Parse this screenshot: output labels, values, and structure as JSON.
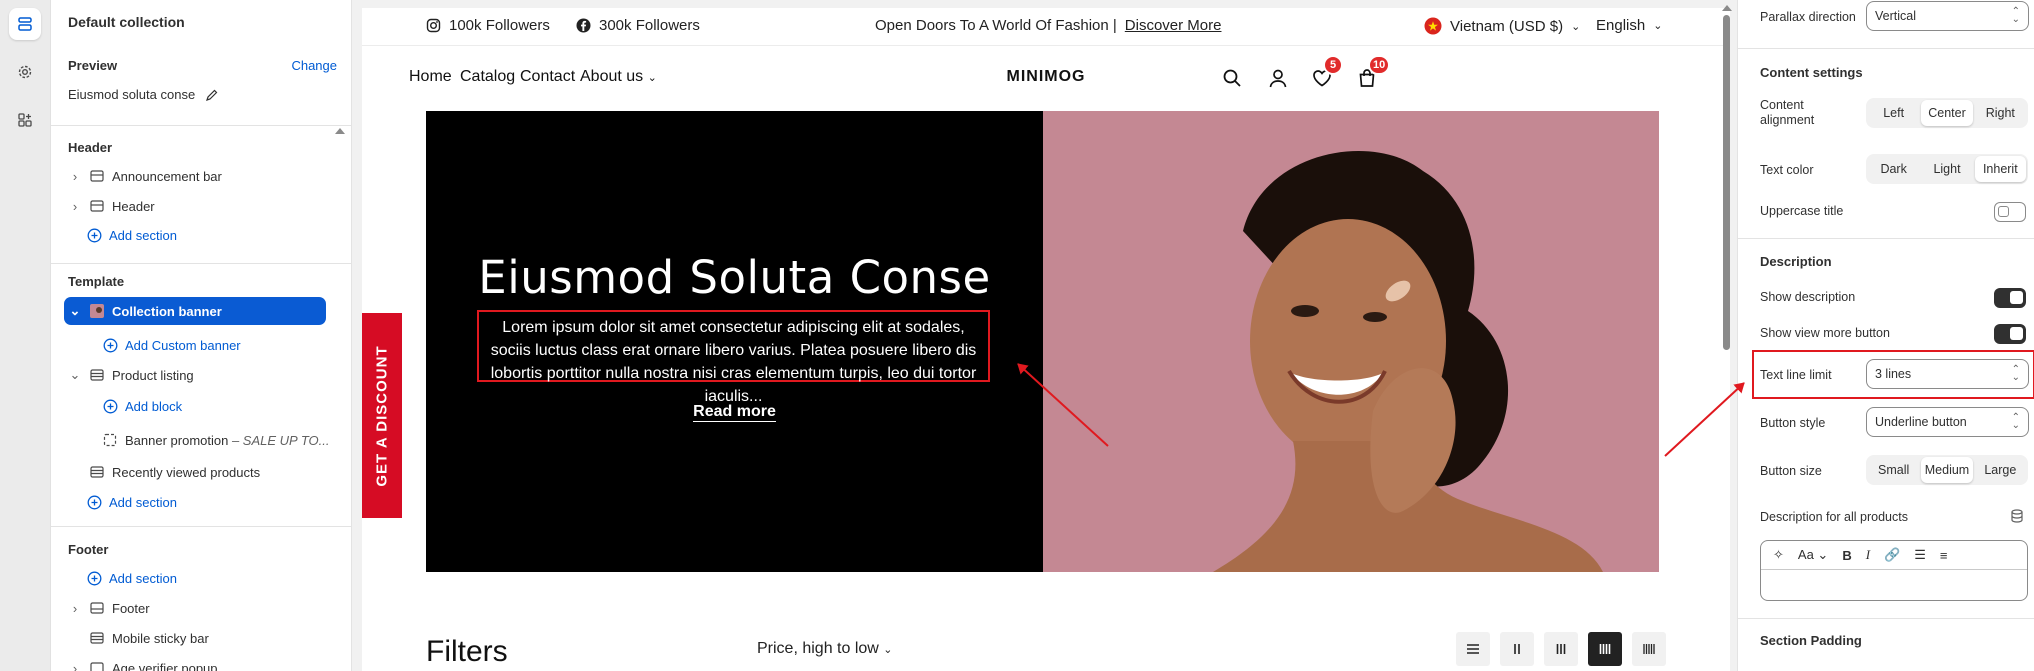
{
  "sidebar": {
    "title": "Default collection",
    "preview_label": "Preview",
    "change_label": "Change",
    "preview_value": "Eiusmod soluta conse",
    "header_group": "Header",
    "header_items": [
      "Announcement bar",
      "Header"
    ],
    "add_section": "Add section",
    "template_group": "Template",
    "selected_item": "Collection banner",
    "add_custom_banner": "Add Custom banner",
    "product_listing": "Product listing",
    "add_block": "Add block",
    "banner_promotion": "Banner promotion",
    "banner_promotion_suffix": "– SALE UP TO...",
    "recently_viewed": "Recently viewed products",
    "footer_group": "Footer",
    "footer_items": [
      "Footer",
      "Mobile sticky bar",
      "Age verifier popup"
    ]
  },
  "store": {
    "instagram": "100k Followers",
    "facebook": "300k Followers",
    "announcement": "Open Doors To A World Of Fashion |",
    "announcement_link": "Discover More",
    "currency": "Vietnam (USD $)",
    "language": "English",
    "nav": [
      "Home",
      "Catalog",
      "Contact",
      "About us"
    ],
    "logo": "MINIMOG",
    "wishlist_count": "5",
    "cart_count": "10",
    "banner_title": "Eiusmod Soluta Conse",
    "banner_desc": "Lorem ipsum dolor sit amet consectetur adipiscing elit at sodales, sociis luctus class erat ornare libero varius. Platea posuere libero dis lobortis porttitor nulla nostra nisi cras elementum turpis, leo dui tortor iaculis...",
    "read_more": "Read more",
    "discount_tab": "GET A DISCOUNT",
    "filters": "Filters",
    "sort": "Price, high to low"
  },
  "settings": {
    "parallax_label": "Parallax direction",
    "parallax_value": "Vertical",
    "content_settings": "Content settings",
    "content_alignment": "Content alignment",
    "alignment_options": [
      "Left",
      "Center",
      "Right"
    ],
    "alignment_selected": "Center",
    "text_color": "Text color",
    "text_color_options": [
      "Dark",
      "Light",
      "Inherit"
    ],
    "text_color_selected": "Inherit",
    "uppercase_title": "Uppercase title",
    "description": "Description",
    "show_description": "Show description",
    "show_view_more": "Show view more button",
    "text_line_limit": "Text line limit",
    "text_line_limit_value": "3 lines",
    "button_style": "Button style",
    "button_style_value": "Underline button",
    "button_size": "Button size",
    "button_size_options": [
      "Small",
      "Medium",
      "Large"
    ],
    "button_size_selected": "Medium",
    "desc_all_products": "Description for all products",
    "section_padding": "Section Padding"
  },
  "colors": {
    "accent_blue": "#005bd3",
    "highlight_red": "#e0191f",
    "banner_pink": "#c48893",
    "badge_red": "#e12b2b"
  }
}
